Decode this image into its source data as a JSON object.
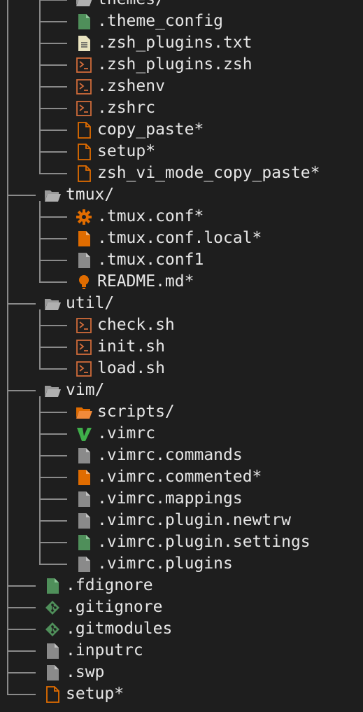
{
  "colors": {
    "background": "#1e1e1e",
    "tree_line": "#8a8a8a",
    "text": "#e6e6e6",
    "shell_orange": "#d06b3a",
    "file_orange": "#e06c00",
    "file_green": "#4f8f5a",
    "file_gray": "#8a8a8a",
    "folder_gray": "#9a9a9a",
    "vim_green": "#3fae4a",
    "text_file": "#e9e3bf"
  },
  "tree": {
    "partial_folder": {
      "name": "themes/",
      "icon": "folder-open-icon"
    },
    "zsh_files": [
      {
        "name": ".theme_config",
        "icon": "file-green-icon"
      },
      {
        "name": ".zsh_plugins.txt",
        "icon": "text-file-icon"
      },
      {
        "name": ".zsh_plugins.zsh",
        "icon": "shell-script-icon"
      },
      {
        "name": ".zshenv",
        "icon": "shell-script-icon"
      },
      {
        "name": ".zshrc",
        "icon": "shell-script-icon"
      },
      {
        "name": "copy_paste*",
        "icon": "file-outline-orange-icon"
      },
      {
        "name": "setup*",
        "icon": "file-outline-orange-icon"
      },
      {
        "name": "zsh_vi_mode_copy_paste*",
        "icon": "file-outline-orange-icon"
      }
    ],
    "folders": [
      {
        "name": "tmux/",
        "icon": "folder-open-icon",
        "children": [
          {
            "name": ".tmux.conf*",
            "icon": "gear-icon"
          },
          {
            "name": ".tmux.conf.local*",
            "icon": "file-orange-icon"
          },
          {
            "name": ".tmux.conf1",
            "icon": "file-gray-icon"
          },
          {
            "name": "README.md*",
            "icon": "lightbulb-icon"
          }
        ]
      },
      {
        "name": "util/",
        "icon": "folder-open-icon",
        "children": [
          {
            "name": "check.sh",
            "icon": "shell-script-icon"
          },
          {
            "name": "init.sh",
            "icon": "shell-script-icon"
          },
          {
            "name": "load.sh",
            "icon": "shell-script-icon"
          }
        ]
      },
      {
        "name": "vim/",
        "icon": "folder-open-icon",
        "children": [
          {
            "name": "scripts/",
            "icon": "folder-orange-icon"
          },
          {
            "name": ".vimrc",
            "icon": "vim-icon"
          },
          {
            "name": ".vimrc.commands",
            "icon": "file-gray-icon"
          },
          {
            "name": ".vimrc.commented*",
            "icon": "file-orange-icon"
          },
          {
            "name": ".vimrc.mappings",
            "icon": "file-gray-icon"
          },
          {
            "name": ".vimrc.plugin.newtrw",
            "icon": "file-gray-icon"
          },
          {
            "name": ".vimrc.plugin.settings",
            "icon": "file-green-icon"
          },
          {
            "name": ".vimrc.plugins",
            "icon": "file-gray-icon"
          }
        ]
      }
    ],
    "root_files": [
      {
        "name": ".fdignore",
        "icon": "file-green-icon"
      },
      {
        "name": ".gitignore",
        "icon": "git-icon"
      },
      {
        "name": ".gitmodules",
        "icon": "git-icon"
      },
      {
        "name": ".inputrc",
        "icon": "file-gray-icon"
      },
      {
        "name": ".swp",
        "icon": "file-gray-icon"
      },
      {
        "name": "setup*",
        "icon": "file-outline-orange-icon"
      }
    ]
  }
}
